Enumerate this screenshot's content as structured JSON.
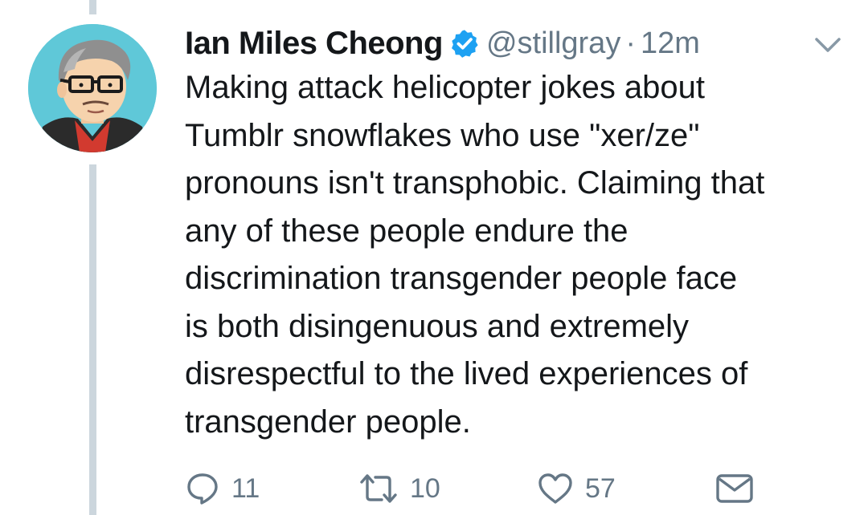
{
  "tweet": {
    "author": {
      "display_name": "Ian Miles Cheong",
      "handle": "@stillgray",
      "verified": true,
      "avatar": "illustrated-portrait-avatar"
    },
    "separator": "·",
    "timestamp": "12m",
    "text": "Making attack helicopter jokes about\nTumblr snowflakes who use \"xer/ze\"\npronouns isn't transphobic. Claiming that\nany of these people endure the\ndiscrimination transgender people face\nis both disingenuous and extremely\ndisrespectful to the lived experiences of\ntransgender people.",
    "actions": {
      "reply": {
        "icon": "reply-icon",
        "count": "11"
      },
      "retweet": {
        "icon": "retweet-icon",
        "count": "10"
      },
      "like": {
        "icon": "heart-icon",
        "count": "57"
      },
      "direct_message": {
        "icon": "envelope-icon"
      }
    },
    "menu_icon": "chevron-down-icon"
  },
  "colors": {
    "text_primary": "#14171a",
    "text_secondary": "#657786",
    "verified_blue": "#1da1f2",
    "thread_line": "#ccd6dd",
    "avatar_background": "#5fc8d8"
  }
}
